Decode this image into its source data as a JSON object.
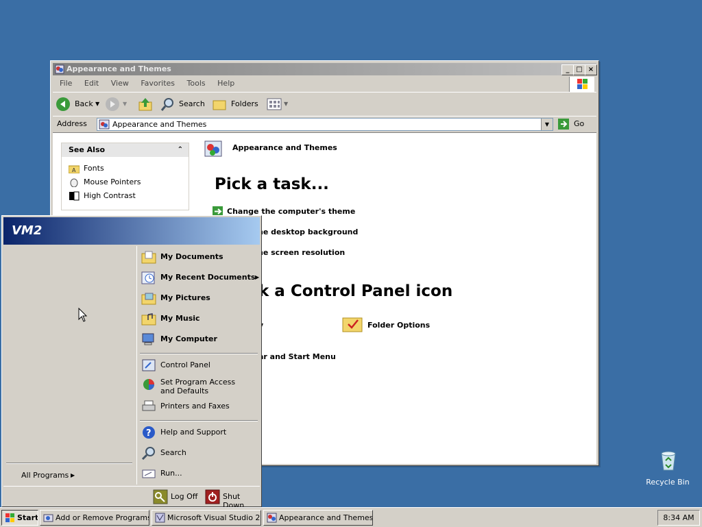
{
  "window": {
    "title": "Appearance and Themes",
    "menu": [
      "File",
      "Edit",
      "View",
      "Favorites",
      "Tools",
      "Help"
    ],
    "toolbar": {
      "back": "Back",
      "search": "Search",
      "folders": "Folders"
    },
    "address": {
      "label": "Address",
      "value": "Appearance and Themes",
      "go": "Go"
    },
    "see_also": {
      "title": "See Also",
      "items": [
        "Fonts",
        "Mouse Pointers",
        "High Contrast"
      ]
    },
    "main": {
      "category": "Appearance and Themes",
      "pick_task": "Pick a task...",
      "tasks": [
        "Change the computer's theme",
        "he desktop background",
        "he screen resolution"
      ],
      "pick_icon": "k a Control Panel icon",
      "icons": [
        "y",
        "Folder Options",
        "ar and Start Menu"
      ]
    }
  },
  "start_menu": {
    "user": "VM2",
    "right_items": [
      {
        "label": "My Documents",
        "bold": true
      },
      {
        "label": "My Recent Documents",
        "bold": true,
        "submenu": true
      },
      {
        "label": "My Pictures",
        "bold": true
      },
      {
        "label": "My Music",
        "bold": true
      },
      {
        "label": "My Computer",
        "bold": true
      },
      {
        "label": "Control Panel"
      },
      {
        "label": "Set Program Access and Defaults"
      },
      {
        "label": "Printers and Faxes"
      },
      {
        "label": "Help and Support"
      },
      {
        "label": "Search"
      },
      {
        "label": "Run..."
      }
    ],
    "all_programs": "All Programs",
    "log_off": "Log Off",
    "shut_down": "Shut Down"
  },
  "taskbar": {
    "start": "Start",
    "buttons": [
      "Add or Remove Programs",
      "Microsoft Visual Studio 2...",
      "Appearance and Themes"
    ],
    "clock": "8:34 AM"
  },
  "desktop": {
    "recycle_bin": "Recycle Bin"
  }
}
